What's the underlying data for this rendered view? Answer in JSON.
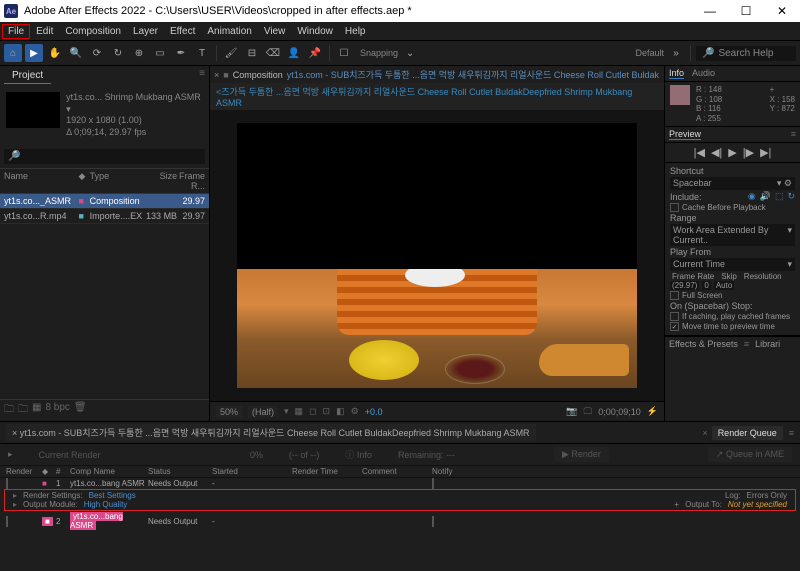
{
  "title": "Adobe After Effects 2022 - C:\\Users\\USER\\Videos\\cropped in after effects.aep *",
  "menus": {
    "file": "File",
    "edit": "Edit",
    "composition": "Composition",
    "layer": "Layer",
    "effect": "Effect",
    "animation": "Animation",
    "view": "View",
    "window": "Window",
    "help": "Help"
  },
  "toolbar": {
    "snapping": "Snapping",
    "default_ws": "Default",
    "search_help": "Search Help"
  },
  "project": {
    "tab": "Project",
    "asset_name": "yt1s.co... Shrimp Mukbang ASMR ▾",
    "asset_res": "1920 x 1080 (1.00)",
    "asset_dur": "Δ 0;09;14, 29.97 fps",
    "search_ph": "",
    "cols": {
      "name": "Name",
      "type": "Type",
      "size": "Size",
      "fr": "Frame R..."
    },
    "rows": [
      {
        "name": "yt1s.co..._ASMR",
        "type": "Composition",
        "size": "",
        "fr": "29.97"
      },
      {
        "name": "yt1s.co...R.mp4",
        "type": "Importe....EX",
        "size": "133 MB",
        "fr": "29.97"
      }
    ],
    "footer": {
      "bpc": "8 bpc"
    }
  },
  "composition": {
    "tab_label": "Composition",
    "tab_name": "yt1s.com - SUB치즈가득 두툼한 ...음면 먹방 새우튀김까지 리얼사운드 Cheese Roll Cutlet Buldak",
    "breadcrumb": "<즈가득 두툼한 ...음면 먹방 새우튀김까지 리얼사운드 Cheese Roll Cutlet BuldakDeepfried Shrimp Mukbang ASMR",
    "zoom": "50%",
    "res": "(Half)",
    "exp": "+0.0",
    "timecode": "0;00;09;10"
  },
  "right": {
    "info_tab": "Info",
    "audio_tab": "Audio",
    "R": "R : 148",
    "G": "G : 108",
    "B": "B : 116",
    "A": "A : 255",
    "X": "X : 158",
    "Y": "Y : 872",
    "preview_tab": "Preview",
    "shortcut_lbl": "Shortcut",
    "shortcut_val": "Spacebar",
    "include_lbl": "Include:",
    "cache_before": "Cache Before Playback",
    "range_lbl": "Range",
    "range_val": "Work Area Extended By Current..",
    "playfrom_lbl": "Play From",
    "playfrom_val": "Current Time",
    "fr_lbl": "Frame Rate",
    "skip_lbl": "Skip",
    "res_lbl": "Resolution",
    "fr_val": "(29.97)",
    "skip_val": "0",
    "res_val": "Auto",
    "fullscreen": "Full Screen",
    "stop_lbl": "On (Spacebar) Stop:",
    "ifcaching": "If caching, play cached frames",
    "movetime": "Move time to preview time",
    "effects_tab": "Effects & Presets",
    "libs_tab": "Librari"
  },
  "bottom": {
    "comp_tab": "yt1s.com - SUB치즈가득 두툼한 ...음면 먹방 새우튀김까지 리얼사운드 Cheese Roll Cutlet BuldakDeepfried Shrimp Mukbang ASMR",
    "rq_tab": "Render Queue",
    "current_render": "Current Render",
    "pct": "0%",
    "dashes": "(-- of --)",
    "info_btn": "Info",
    "remaining": "Remaining: ---",
    "render_btn": "Render",
    "queue_ame": "Queue in AME",
    "cols": {
      "render": "Render",
      "num": "#",
      "comp": "Comp Name",
      "status": "Status",
      "started": "Started",
      "rtime": "Render Time",
      "comment": "Comment",
      "notify": "Notify"
    },
    "row1": {
      "num": "1",
      "comp": "yt1s.co...bang ASMR",
      "status": "Needs Output",
      "started": "-"
    },
    "rs_lbl": "Render Settings:",
    "rs_val": "Best Settings",
    "log_lbl": "Log:",
    "log_val": "Errors Only",
    "om_lbl": "Output Module:",
    "om_val": "High Quality",
    "out_lbl": "Output To:",
    "out_val": "Not yet specified",
    "row2": {
      "num": "2",
      "comp": "yt1s.co...bang ASMR",
      "status": "Needs Output",
      "started": "-"
    }
  }
}
